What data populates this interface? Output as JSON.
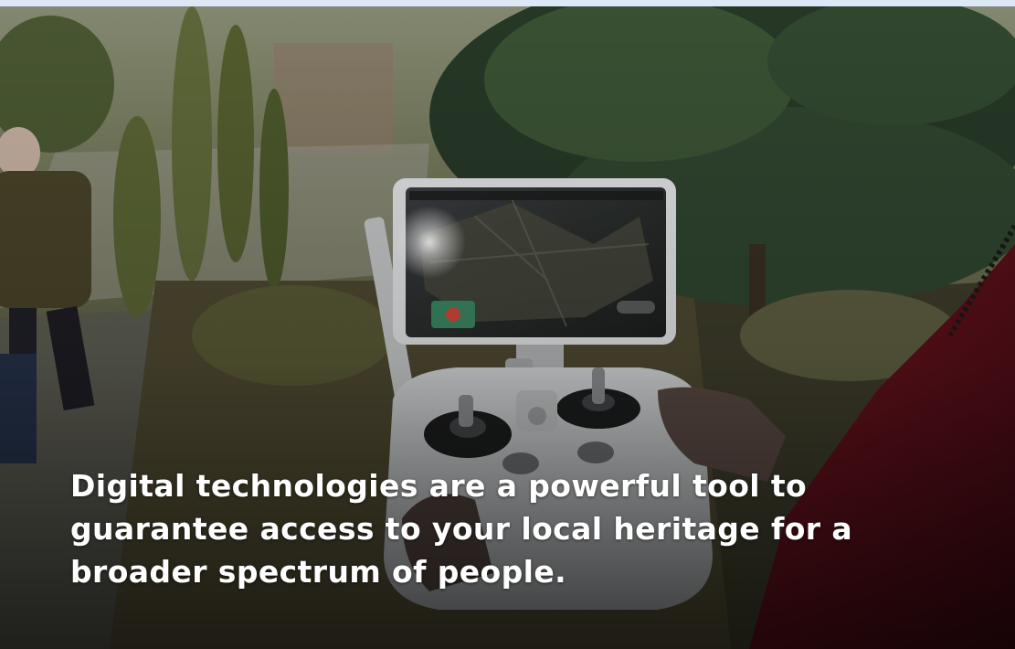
{
  "hero": {
    "caption": "Digital technologies are a powerful tool to guarantee access to your local heritage for a broader spectrum of people."
  }
}
